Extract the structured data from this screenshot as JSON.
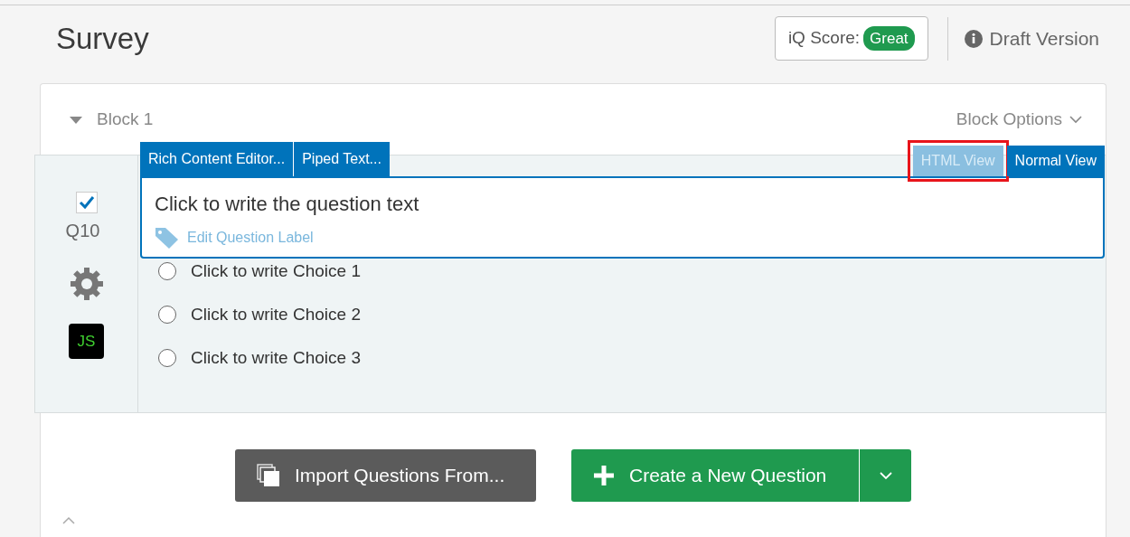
{
  "header": {
    "title": "Survey",
    "iq_score": {
      "label": "iQ Score:",
      "badge": "Great"
    },
    "version": "Draft Version"
  },
  "block": {
    "title": "Block 1",
    "expanded": true,
    "options": "Block Options",
    "question": {
      "number": "Q10",
      "checked": true,
      "js_label": "JS",
      "editor": {
        "tools": [
          "Rich Content Editor...",
          "Piped Text..."
        ],
        "views": [
          {
            "label": "HTML View",
            "selected": false,
            "highlighted": true
          },
          {
            "label": "Normal View",
            "selected": true,
            "highlighted": false
          }
        ],
        "text": "Click to write the question text",
        "label_link": "Edit Question Label"
      },
      "choices": [
        {
          "label": "Click to write Choice 1",
          "selected": false
        },
        {
          "label": "Click to write Choice 2",
          "selected": false
        },
        {
          "label": "Click to write Choice 3",
          "selected": false
        }
      ]
    },
    "actions": {
      "import": "Import Questions From...",
      "create": "Create a New Question"
    }
  }
}
